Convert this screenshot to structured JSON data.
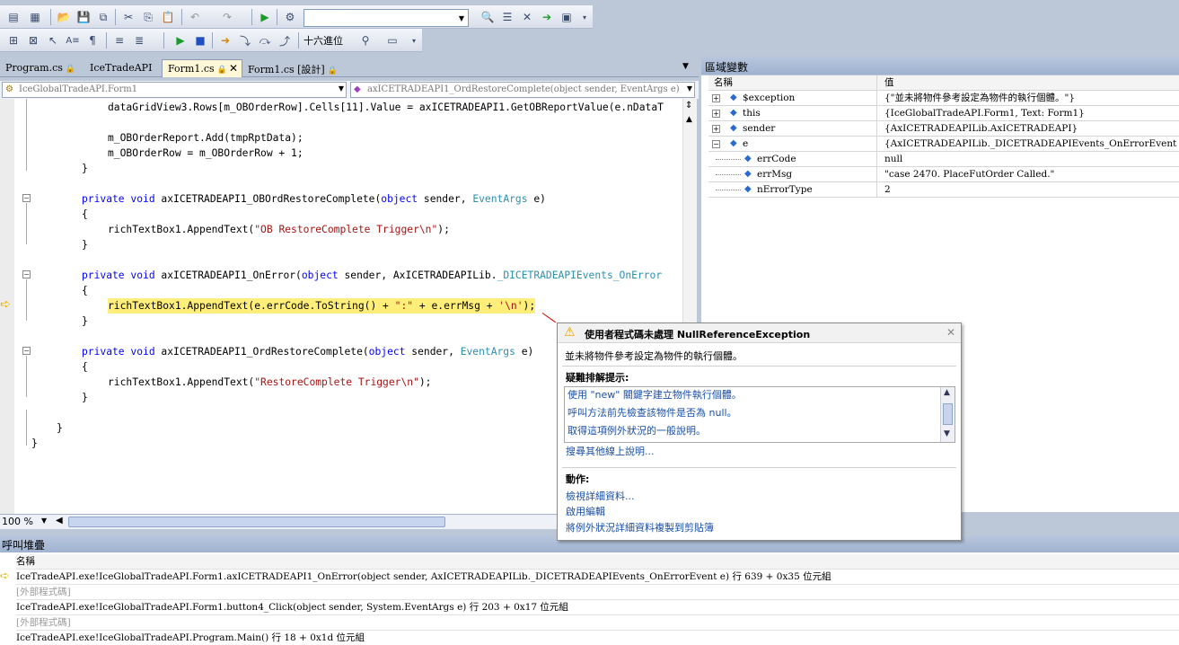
{
  "toolbar": {
    "combo_value": "",
    "hex_label": "十六進位"
  },
  "tabs": [
    {
      "label": "Program.cs",
      "locked": true
    },
    {
      "label": "IceTradeAPI",
      "locked": false
    },
    {
      "label": "Form1.cs",
      "locked": true,
      "active": true
    },
    {
      "label": "Form1.cs [設計]",
      "locked": true
    }
  ],
  "nav": {
    "class_combo": "IceGlobalTradeAPI.Form1",
    "member_combo": "axICETRADEAPI1_OrdRestoreComplete(object sender, EventArgs e)"
  },
  "code": {
    "l1": "dataGridView3.Rows[m_OBOrderRow].Cells[11].Value = axICETRADEAPI1.GetOBReportValue(e.nDataT",
    "l2": "m_OBOrderReport.Add(tmpRptData);",
    "l3": "m_OBOrderRow = m_OBOrderRow + 1;",
    "l4": "}",
    "l5_kw1": "private void",
    "l5_name": " axICETRADEAPI1_OBOrdRestoreComplete(",
    "l5_kw2": "object",
    "l5_mid": " sender, ",
    "l5_ty": "EventArgs",
    "l5_end": " e)",
    "l6": "{",
    "l7_pre": "richTextBox1.AppendText(",
    "l7_str": "\"OB RestoreComplete Trigger\\n\"",
    "l7_end": ");",
    "l8": "}",
    "l9_kw1": "private void",
    "l9_name": " axICETRADEAPI1_OnError(",
    "l9_kw2": "object",
    "l9_mid": " sender, AxICETRADEAPILib.",
    "l9_ty": "_DICETRADEAPIEvents_OnError",
    "l10": "{",
    "l11_pre": "richTextBox1.AppendText(e.errCode.ToString() + ",
    "l11_s1": "\":\"",
    "l11_mid": " + e.errMsg + ",
    "l11_s2": "'\\n'",
    "l11_end": ");",
    "l12": "}",
    "l13_kw1": "private void",
    "l13_name": " axICETRADEAPI1_OrdRestoreComplete(",
    "l13_kw2": "object",
    "l13_mid": " sender, ",
    "l13_ty": "EventArgs",
    "l13_end": " e)",
    "l14": "{",
    "l15_pre": "richTextBox1.AppendText(",
    "l15_str": "\"RestoreComplete Trigger\\n\"",
    "l15_end": ");",
    "l16": "}",
    "l17": "}",
    "l18": "}"
  },
  "zoom": "100 %",
  "locals": {
    "title": "區域變數",
    "col_name": "名稱",
    "col_value": "值",
    "rows": [
      {
        "name": "$exception",
        "value": "{\"並未將物件參考設定為物件的執行個體。\"}"
      },
      {
        "name": "this",
        "value": "{IceGlobalTradeAPI.Form1, Text: Form1}"
      },
      {
        "name": "sender",
        "value": "{AxICETRADEAPILib.AxICETRADEAPI}"
      },
      {
        "name": "e",
        "value": "{AxICETRADEAPILib._DICETRADEAPIEvents_OnErrorEvent}"
      },
      {
        "name": "errCode",
        "value": "null"
      },
      {
        "name": "errMsg",
        "value": "\"case 2470. PlaceFutOrder Called.\""
      },
      {
        "name": "nErrorType",
        "value": "2"
      }
    ]
  },
  "exception": {
    "title": "使用者程式碼未處理 NullReferenceException",
    "message": "並未將物件參考設定為物件的執行個體。",
    "tips_heading": "疑難排解提示:",
    "tips": [
      "使用 \"new\" 關鍵字建立物件執行個體。",
      "呼叫方法前先檢查該物件是否為 null。",
      "取得這項例外狀況的一般說明。"
    ],
    "search_link": "搜尋其他線上說明...",
    "actions_heading": "動作:",
    "actions": [
      "檢視詳細資料...",
      "啟用編輯",
      "將例外狀況詳細資料複製到剪貼簿"
    ]
  },
  "callstack": {
    "title": "呼叫堆疊",
    "col_name": "名稱",
    "rows": [
      {
        "text": "IceTradeAPI.exe!IceGlobalTradeAPI.Form1.axICETRADEAPI1_OnError(object sender, AxICETRADEAPILib._DICETRADEAPIEvents_OnErrorEvent e) 行 639 + 0x35 位元組",
        "external": false,
        "current": true
      },
      {
        "text": "[外部程式碼]",
        "external": true,
        "current": false
      },
      {
        "text": "IceTradeAPI.exe!IceGlobalTradeAPI.Form1.button4_Click(object sender, System.EventArgs e) 行 203 + 0x17 位元組",
        "external": false,
        "current": false
      },
      {
        "text": "[外部程式碼]",
        "external": true,
        "current": false
      },
      {
        "text": "IceTradeAPI.exe!IceGlobalTradeAPI.Program.Main() 行 18 + 0x1d 位元組",
        "external": false,
        "current": false
      }
    ]
  },
  "colors": {
    "highlight": "#ffef7a",
    "keyword": "#0000ff",
    "type": "#2b91af",
    "string": "#a31515",
    "link": "#1a4fa8"
  }
}
